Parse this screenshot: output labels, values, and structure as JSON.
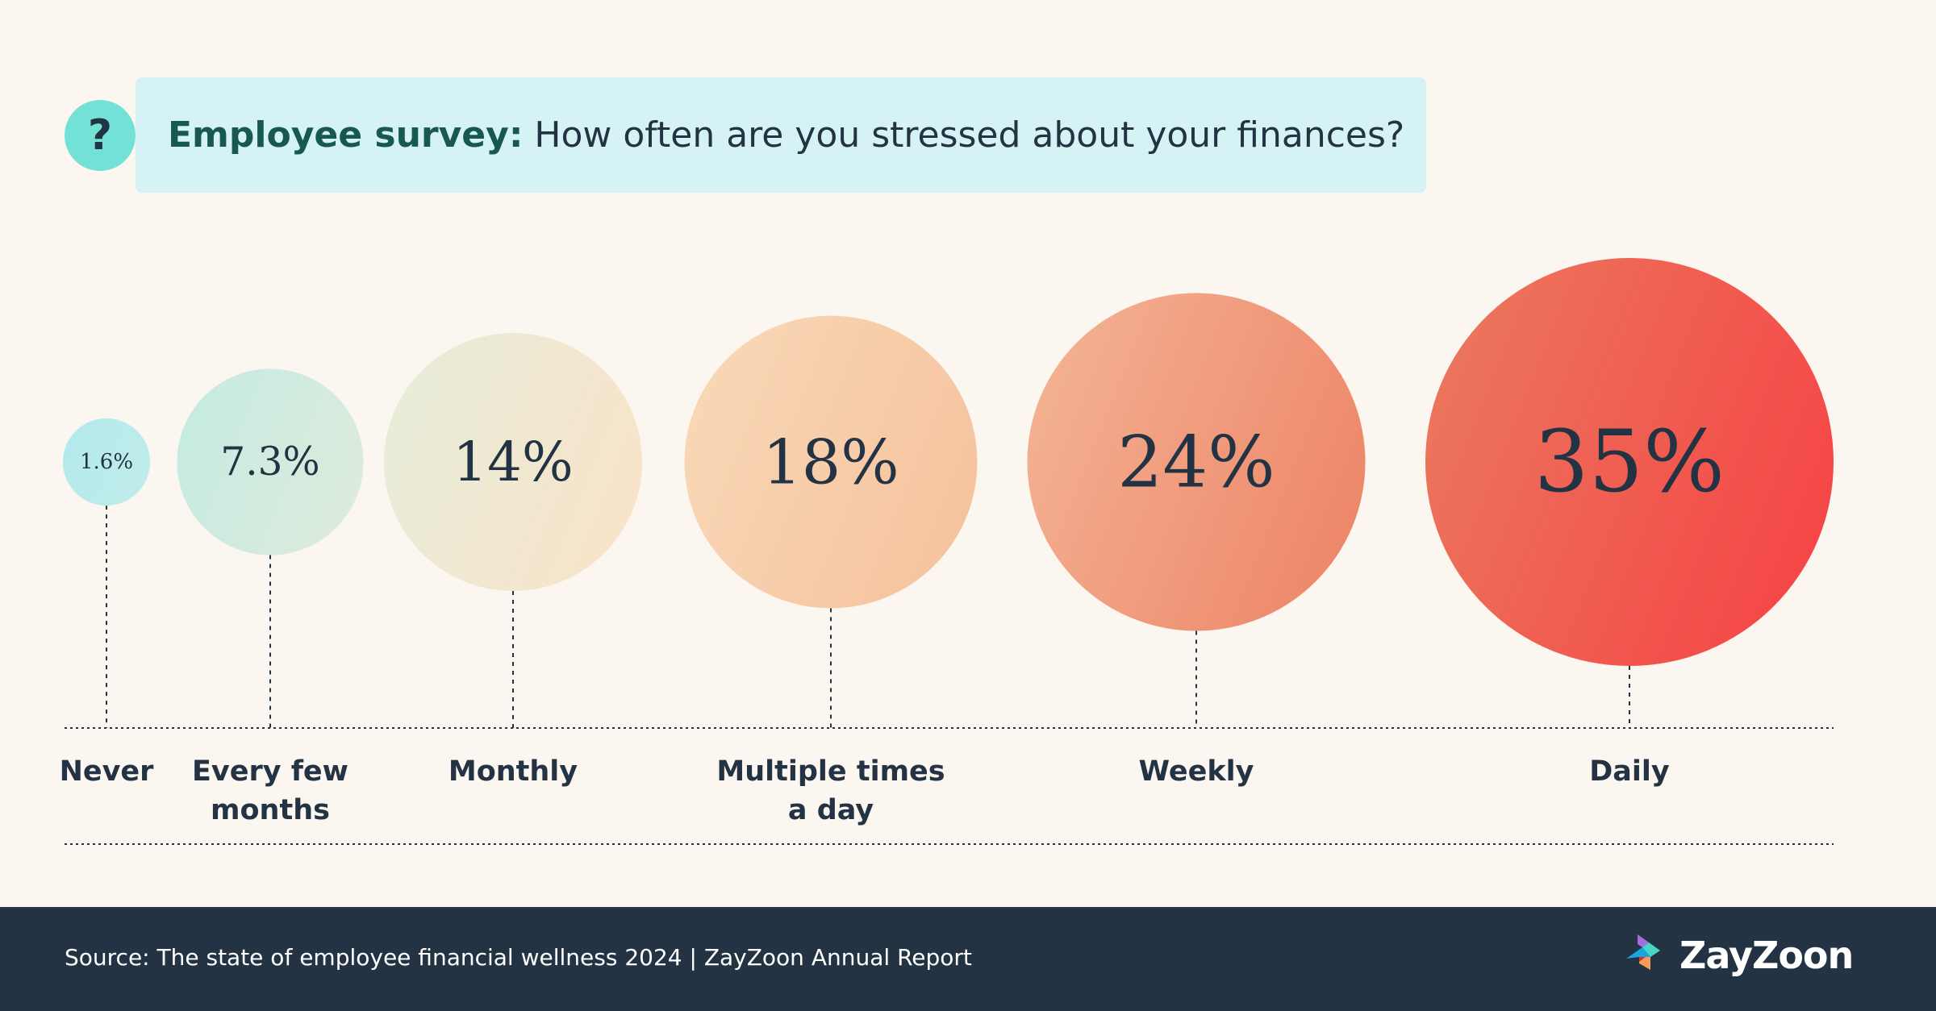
{
  "header": {
    "icon": "question-mark-icon",
    "icon_glyph": "?",
    "title_lead": "Employee survey:",
    "title_rest": " How often are you stressed about your finances?"
  },
  "chart_data": {
    "type": "bubble",
    "title": "Employee survey: How often are you stressed about your finances?",
    "categories": [
      "Never",
      "Every few months",
      "Monthly",
      "Multiple times a day",
      "Weekly",
      "Daily"
    ],
    "label_lines": [
      [
        "Never"
      ],
      [
        "Every few",
        "months"
      ],
      [
        "Monthly"
      ],
      [
        "Multiple times",
        "a day"
      ],
      [
        "Weekly"
      ],
      [
        "Daily"
      ]
    ],
    "values": [
      1.6,
      7.3,
      14,
      18,
      24,
      35
    ],
    "value_labels": [
      "1.6%",
      "7.3%",
      "14%",
      "18%",
      "24%",
      "35%"
    ],
    "unit": "%",
    "colors": [
      [
        "#b4eaec",
        "#c0ecea"
      ],
      [
        "#c6ebe1",
        "#dcebdc"
      ],
      [
        "#e8ecd8",
        "#f8e4c9"
      ],
      [
        "#f8d8b6",
        "#f6c29e"
      ],
      [
        "#f3b192",
        "#ee8668"
      ],
      [
        "#eb765d",
        "#f54545"
      ]
    ],
    "grid": false,
    "legend": "none"
  },
  "footer": {
    "source": "Source: The state of employee financial wellness 2024 | ZayZoon Annual Report",
    "logo_text": "ZayZoon"
  },
  "colors": {
    "background": "#fbf6f0",
    "title_box": "#d5f3f4",
    "title_accent": "#17594f",
    "text": "#233343",
    "footer_bg": "#233343",
    "icon_bg": "#74e1d7"
  }
}
